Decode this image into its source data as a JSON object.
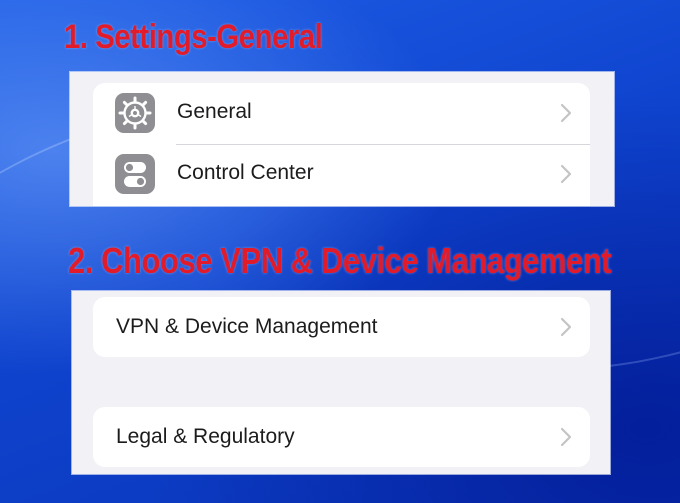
{
  "instructions": {
    "step1": "1. Settings-General",
    "step2": "2. Choose VPN & Device Management"
  },
  "settings_list_1": {
    "items": [
      {
        "label": "General",
        "icon": "gear-icon"
      },
      {
        "label": "Control Center",
        "icon": "switches-icon"
      }
    ]
  },
  "settings_list_2": {
    "items": [
      {
        "label": "VPN & Device Management"
      },
      {
        "label": "Legal & Regulatory"
      }
    ]
  },
  "colors": {
    "instruction_text": "#e21b2a",
    "background": "#1548d8",
    "panel": "#f1f1f6",
    "icon_tile": "#8e8e93",
    "chevron": "#c4c4c7"
  }
}
